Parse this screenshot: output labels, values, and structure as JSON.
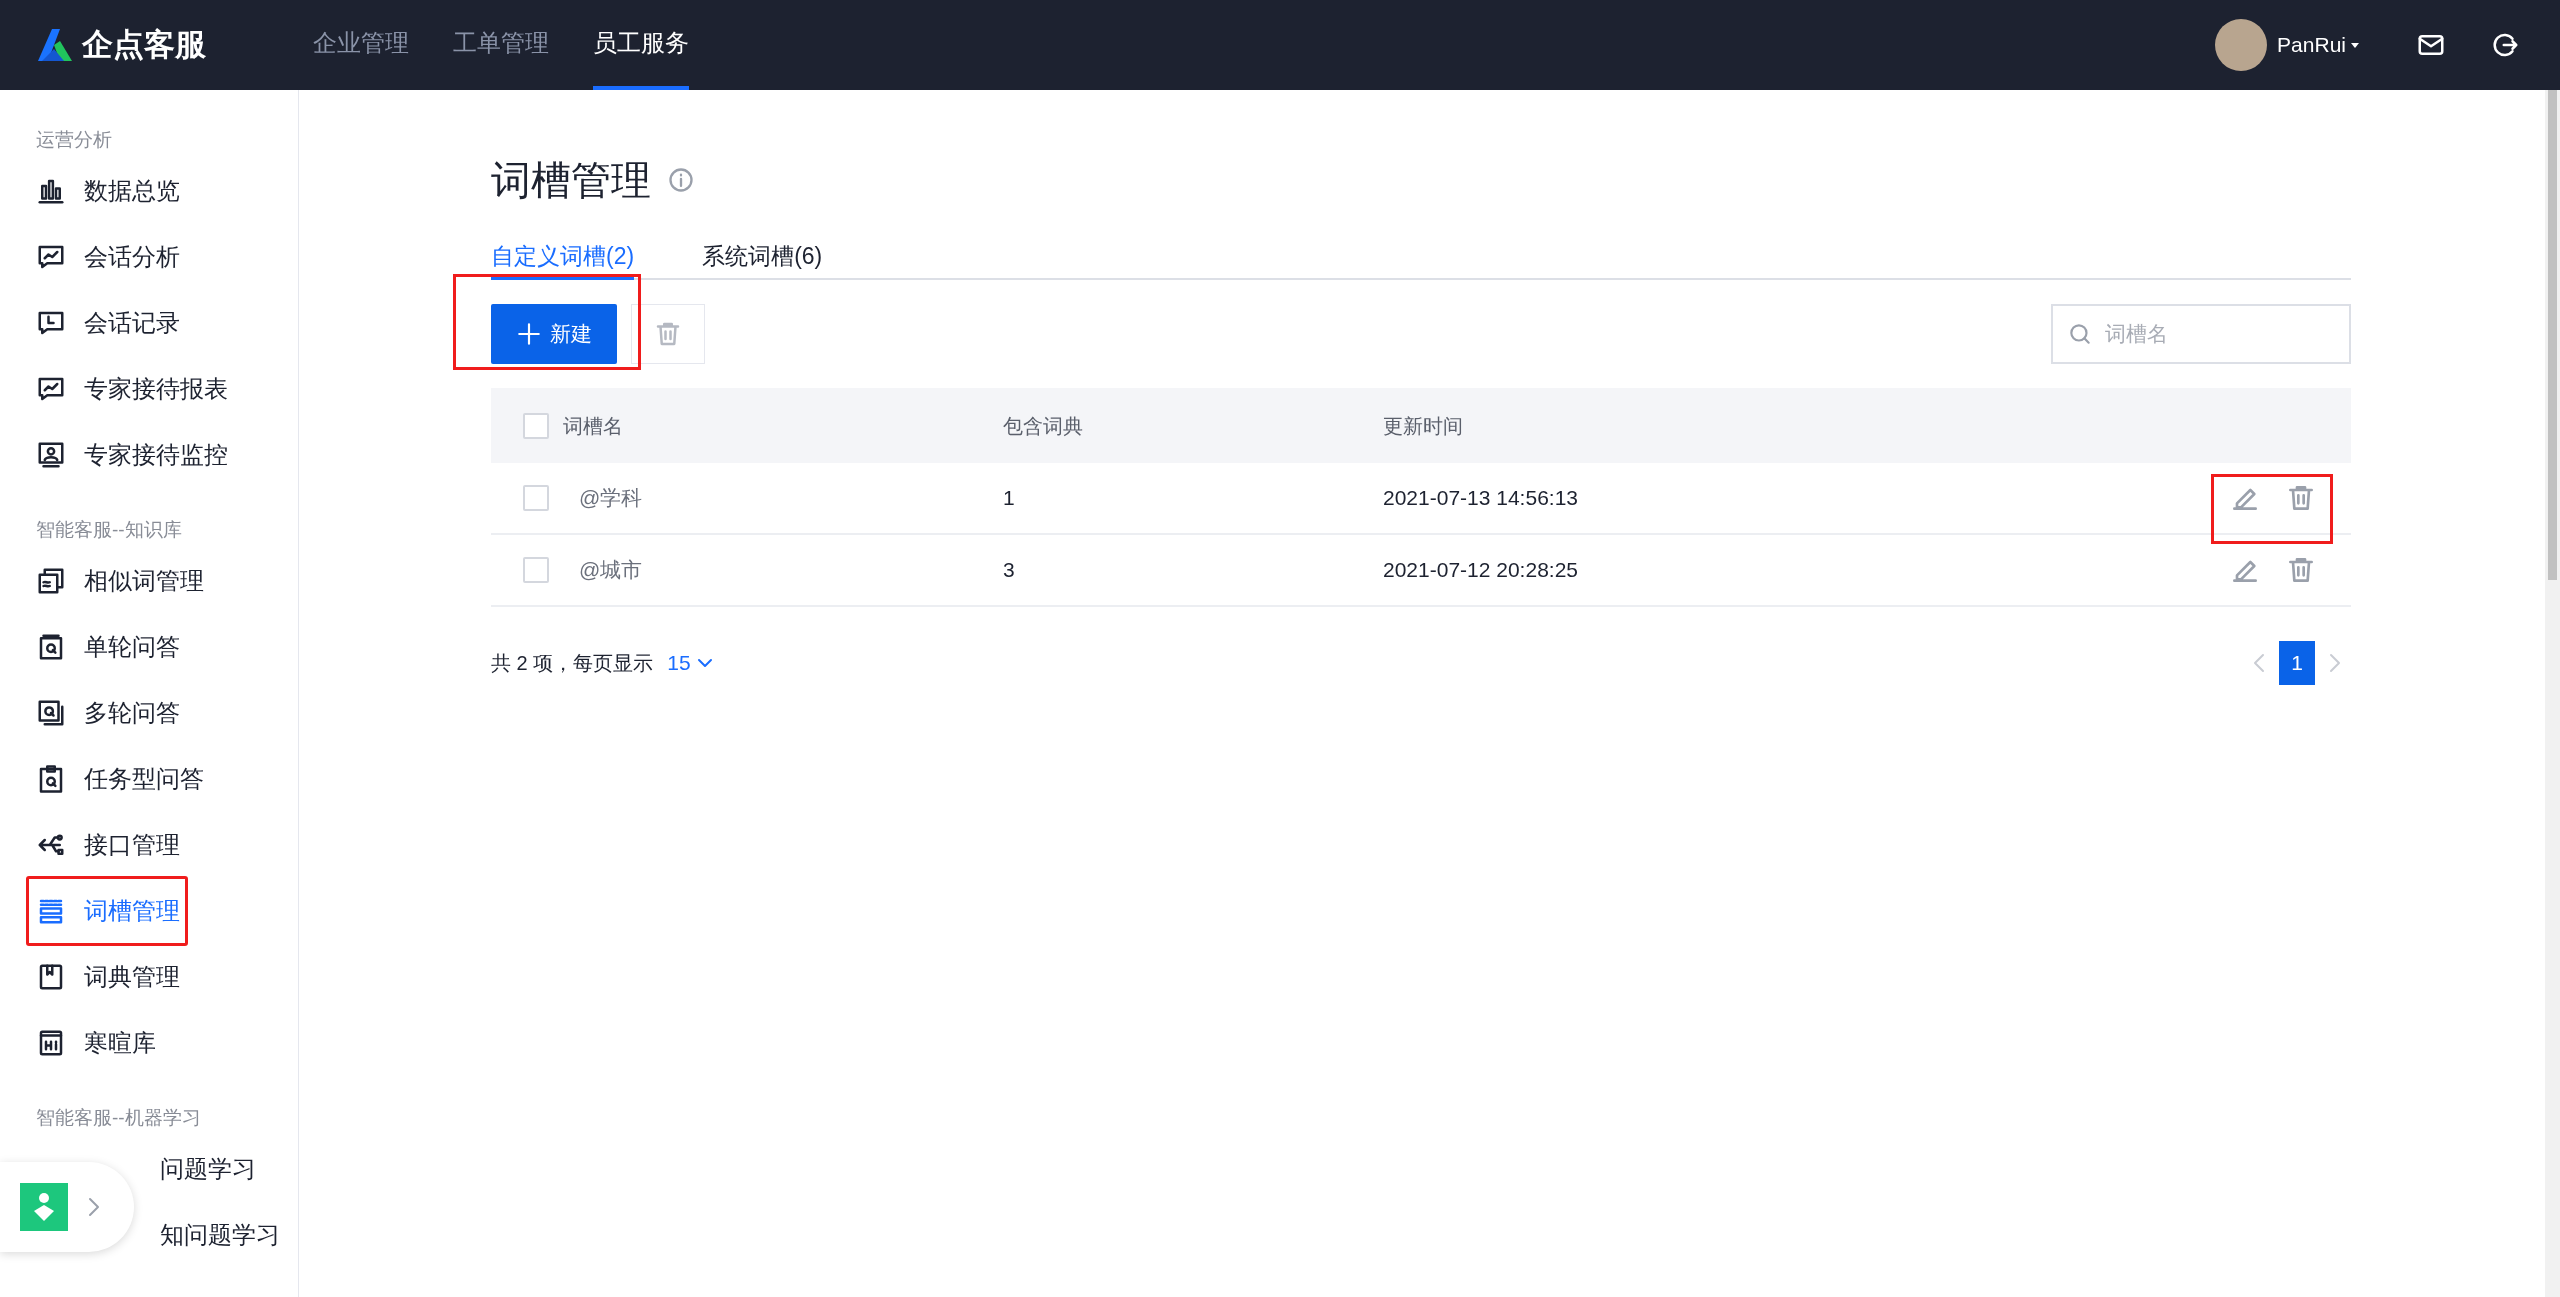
{
  "header": {
    "logo": "企点客服",
    "nav": [
      {
        "label": "企业管理",
        "selected": false
      },
      {
        "label": "工单管理",
        "selected": false
      },
      {
        "label": "员工服务",
        "selected": true
      }
    ],
    "user": "PanRui"
  },
  "sidebar": {
    "sections": [
      {
        "title": "运营分析",
        "items": [
          {
            "label": "数据总览",
            "selected": false,
            "highlighted": false,
            "kind": "item"
          },
          {
            "label": "会话分析",
            "selected": false,
            "highlighted": false,
            "kind": "item"
          },
          {
            "label": "会话记录",
            "selected": false,
            "highlighted": false,
            "kind": "item"
          },
          {
            "label": "专家接待报表",
            "selected": false,
            "highlighted": false,
            "kind": "item"
          },
          {
            "label": "专家接待监控",
            "selected": false,
            "highlighted": false,
            "kind": "item"
          }
        ]
      },
      {
        "title": "智能客服--知识库",
        "items": [
          {
            "label": "相似词管理",
            "selected": false,
            "highlighted": false,
            "kind": "item"
          },
          {
            "label": "单轮问答",
            "selected": false,
            "highlighted": false,
            "kind": "item"
          },
          {
            "label": "多轮问答",
            "selected": false,
            "highlighted": false,
            "kind": "item"
          },
          {
            "label": "任务型问答",
            "selected": false,
            "highlighted": false,
            "kind": "item"
          },
          {
            "label": "接口管理",
            "selected": false,
            "highlighted": false,
            "kind": "item"
          },
          {
            "label": "词槽管理",
            "selected": true,
            "highlighted": true,
            "kind": "item"
          },
          {
            "label": "词典管理",
            "selected": false,
            "highlighted": false,
            "kind": "item"
          },
          {
            "label": "寒暄库",
            "selected": false,
            "highlighted": false,
            "kind": "item"
          }
        ]
      },
      {
        "title": "智能客服--机器学习",
        "items": [
          {
            "label": "问题学习",
            "selected": false,
            "highlighted": false,
            "kind": "covered"
          },
          {
            "label": "知问题学习",
            "selected": false,
            "highlighted": false,
            "kind": "covered"
          }
        ]
      }
    ]
  },
  "page": {
    "title": "词槽管理",
    "tabs": [
      {
        "label": "自定义词槽(2)",
        "selected": true
      },
      {
        "label": "系统词槽(6)",
        "selected": false
      }
    ],
    "new_button": {
      "label": "新建",
      "highlighted": true
    },
    "search": {
      "placeholder": "词槽名"
    },
    "table": {
      "all_checked": false,
      "columns": [
        "词槽名",
        "包含词典",
        "更新时间"
      ],
      "rows": [
        {
          "name": "@学科",
          "count": "1",
          "updated": "2021-07-13 14:56:13",
          "checked": false,
          "actions_highlighted": true
        },
        {
          "name": "@城市",
          "count": "3",
          "updated": "2021-07-12 20:28:25",
          "checked": false,
          "actions_highlighted": false
        }
      ]
    },
    "pagination": {
      "summary": "共 2 项，每页显示",
      "page_size": "15",
      "pages": [
        {
          "label": "1",
          "selected": true
        }
      ]
    }
  }
}
